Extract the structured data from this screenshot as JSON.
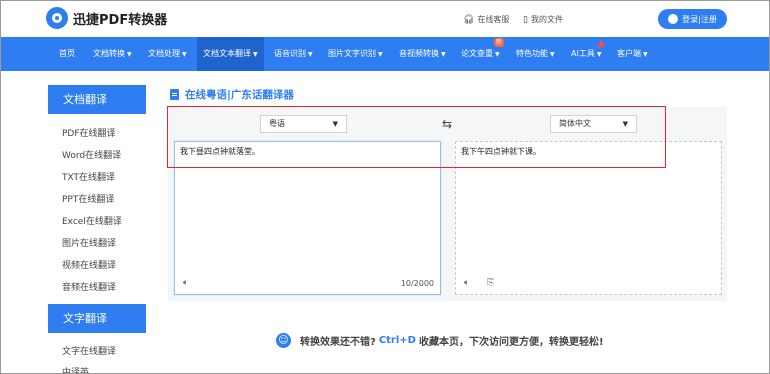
{
  "header": {
    "logo_text": "迅捷PDF转换器",
    "online_service": "在线客服",
    "my_files": "我的文件",
    "login_register": "登录|注册"
  },
  "nav": {
    "items": [
      {
        "label": "首页",
        "has_caret": false
      },
      {
        "label": "文档转换",
        "has_caret": true
      },
      {
        "label": "文档处理",
        "has_caret": true
      },
      {
        "label": "文档文本翻译",
        "has_caret": true,
        "active": true
      },
      {
        "label": "语音识别",
        "has_caret": true
      },
      {
        "label": "图片文字识别",
        "has_caret": true
      },
      {
        "label": "音视频转换",
        "has_caret": true
      },
      {
        "label": "论文查重",
        "has_caret": true,
        "badge": "新"
      },
      {
        "label": "特色功能",
        "has_caret": true
      },
      {
        "label": "AI工具",
        "has_caret": true
      },
      {
        "label": "客户端",
        "has_caret": true
      }
    ]
  },
  "sidebar": {
    "sections": [
      {
        "heading": "文档翻译",
        "items": [
          "PDF在线翻译",
          "Word在线翻译",
          "TXT在线翻译",
          "PPT在线翻译",
          "Excel在线翻译",
          "图片在线翻译",
          "视频在线翻译",
          "音频在线翻译"
        ]
      },
      {
        "heading": "文字翻译",
        "items": [
          "文字在线翻译",
          "中译英"
        ]
      }
    ]
  },
  "main": {
    "title": "在线粤语|广东话翻译器",
    "source_lang": "粤语",
    "target_lang": "简体中文",
    "source_text": "我下昼四点钟就落堂。",
    "target_text": "我下午四点钟就下课。",
    "char_count": "10/2000"
  },
  "tip": {
    "prefix": "转换效果还不错?",
    "shortcut": "Ctrl+D",
    "suffix": "收藏本页，下次访问更方便，转换更轻松!"
  },
  "colors": {
    "brand_blue": "#2e7ef2",
    "highlight_red": "#e02a2a"
  }
}
